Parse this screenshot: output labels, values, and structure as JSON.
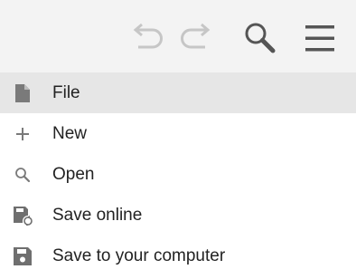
{
  "toolbar": {
    "undo_icon": "undo-arrow-icon",
    "redo_icon": "redo-arrow-icon",
    "search_icon": "magnifier-icon",
    "menu_icon": "hamburger-icon"
  },
  "menu": {
    "header": {
      "label": "File",
      "icon": "document-icon"
    },
    "items": [
      {
        "label": "New",
        "icon": "plus-icon"
      },
      {
        "label": "Open",
        "icon": "magnifier-icon"
      },
      {
        "label": "Save online",
        "icon": "save-online-icon"
      },
      {
        "label": "Save to your computer",
        "icon": "floppy-disk-icon"
      }
    ]
  },
  "colors": {
    "toolbar_bg": "#f3f3f3",
    "header_bg": "#e6e6e6",
    "icon_gray": "#7a7a7a",
    "icon_dark": "#555555",
    "disabled_icon": "#c6c6c6",
    "text": "#222222"
  }
}
